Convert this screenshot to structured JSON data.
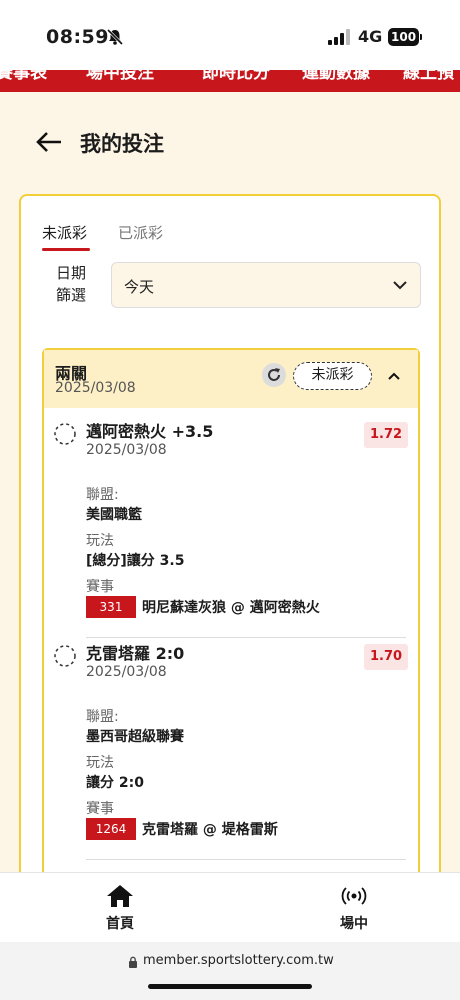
{
  "status_bar": {
    "time": "08:59",
    "network": "4G",
    "battery": "100"
  },
  "top_nav": {
    "items": [
      "賽事表",
      "場中投注",
      "即時比分",
      "運動數據",
      "線上預"
    ]
  },
  "header": {
    "title": "我的投注"
  },
  "tabs": {
    "active": "未派彩",
    "inactive": "已派彩"
  },
  "filter": {
    "label_line1": "日期",
    "label_line2": "篩選",
    "value": "今天"
  },
  "parlay": {
    "title": "兩關",
    "date": "2025/03/08",
    "status": "未派彩",
    "selections": [
      {
        "title": "邁阿密熱火 +3.5",
        "date": "2025/03/08",
        "odds": "1.72",
        "league_label": "聯盟:",
        "league": "美國職籃",
        "play_label": "玩法",
        "play": "[總分]讓分 3.5",
        "match_label": "賽事",
        "match_no": "331",
        "match": "明尼蘇達灰狼 @ 邁阿密熱火"
      },
      {
        "title": "克雷塔羅 2:0",
        "date": "2025/03/08",
        "odds": "1.70",
        "league_label": "聯盟:",
        "league": "墨西哥超級聯賽",
        "play_label": "玩法",
        "play": "讓分 2:0",
        "match_label": "賽事",
        "match_no": "1264",
        "match": "克雷塔羅 @ 堤格雷斯"
      }
    ]
  },
  "bottom_nav": {
    "home": "首頁",
    "live": "場中"
  },
  "browser": {
    "url": "member.sportslottery.com.tw"
  },
  "colors": {
    "brand_red": "#c8161d",
    "accent_yellow": "#f2cf3a",
    "header_yellow": "#fdf0c7"
  },
  "icons": {
    "bell": "bell-slash-icon",
    "signal": "signal-icon",
    "back": "arrow-left-icon",
    "refresh": "refresh-icon",
    "pending": "dashed-circle-icon",
    "home": "home-icon",
    "live": "broadcast-icon",
    "lock": "lock-icon"
  }
}
